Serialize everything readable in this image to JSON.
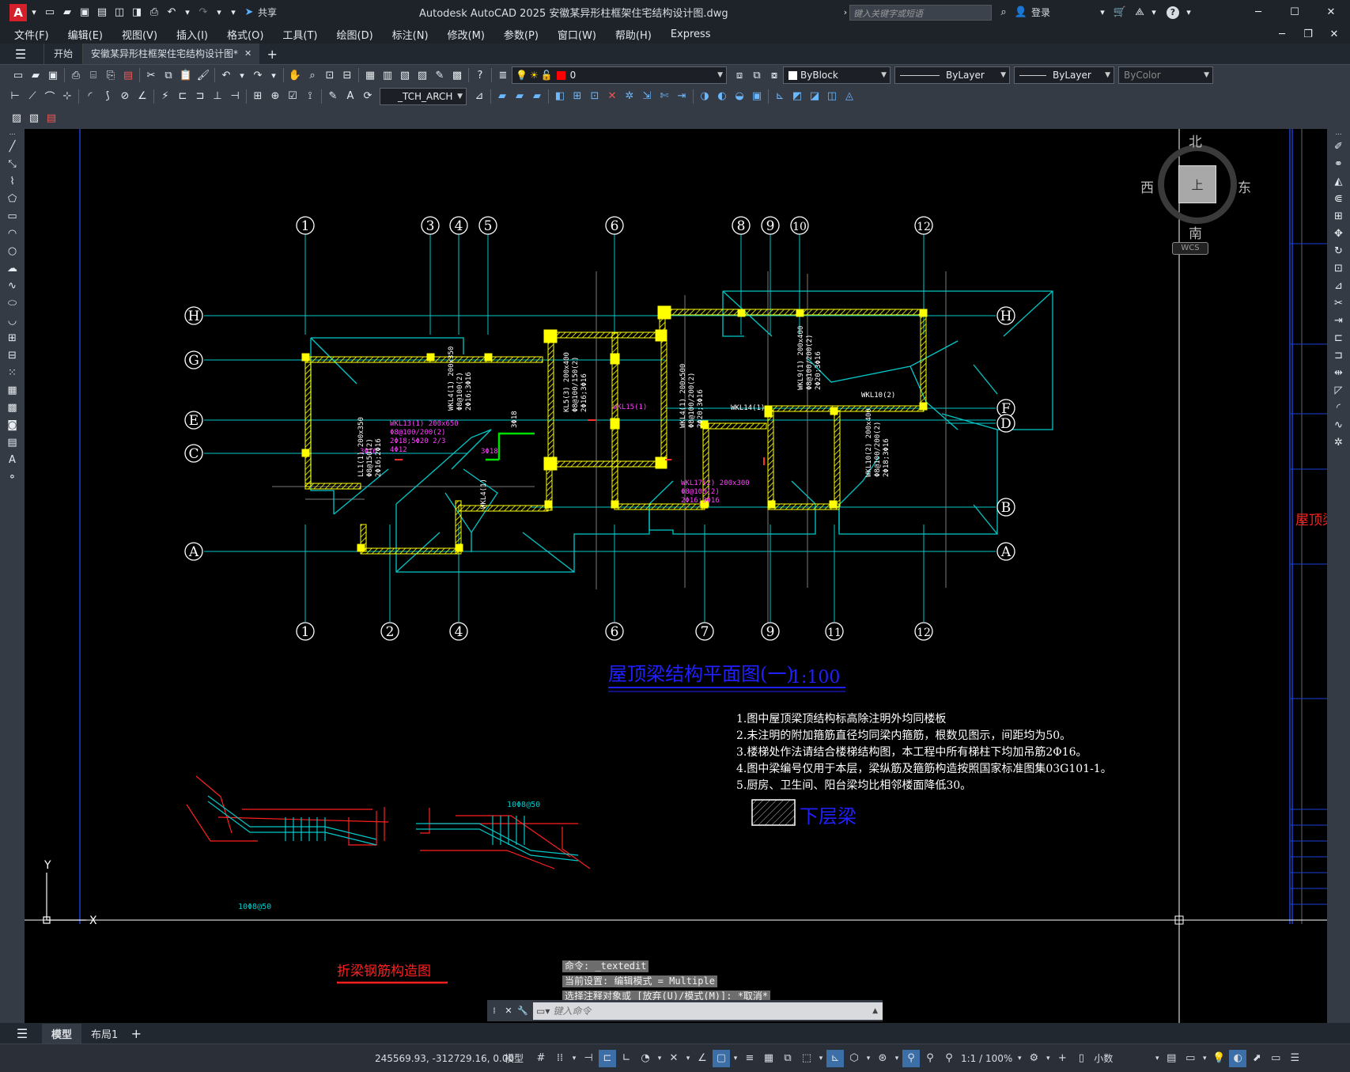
{
  "titlebar": {
    "app_letter": "A",
    "share_label": "共享",
    "title": "Autodesk AutoCAD 2025    安徽某异形柱框架住宅结构设计图.dwg",
    "search_placeholder": "键入关键字或短语",
    "login_label": "登录"
  },
  "menus": [
    "文件(F)",
    "编辑(E)",
    "视图(V)",
    "插入(I)",
    "格式(O)",
    "工具(T)",
    "绘图(D)",
    "标注(N)",
    "修改(M)",
    "参数(P)",
    "窗口(W)",
    "帮助(H)",
    "Express"
  ],
  "tabs": {
    "start": "开始",
    "active": "安徽某异形柱框架住宅结构设计图*"
  },
  "properties": {
    "layer_value": "0",
    "color": "ByBlock",
    "linetype": "ByLayer",
    "lineweight": "ByLayer",
    "plotstyle": "ByColor",
    "textstyle": "_TCH_ARCH"
  },
  "viewcube": {
    "north": "北",
    "south": "南",
    "east": "东",
    "west": "西",
    "top": "上",
    "wcs": "WCS"
  },
  "drawing": {
    "top_axes": [
      "1",
      "3",
      "4",
      "5",
      "6",
      "8",
      "9",
      "10",
      "12"
    ],
    "bottom_axes": [
      "1",
      "2",
      "4",
      "6",
      "7",
      "9",
      "11",
      "12"
    ],
    "left_rows": [
      "H",
      "G",
      "E",
      "C",
      "A"
    ],
    "right_rows": [
      "H",
      "F",
      "D",
      "B",
      "A"
    ],
    "plan_title": "屋顶梁结构平面图(一)",
    "plan_scale": "1:100",
    "notes": [
      "1.图中屋顶梁顶结构标高除注明外均同楼板",
      "2.未注明的附加箍筋直径均同梁内箍筋，根数见图示，间距均为50。",
      "3.楼梯处作法请结合楼梯结构图，本工程中所有梯柱下均加吊筋2Φ16。",
      "4.图中梁编号仅用于本层，梁纵筋及箍筋构造按照国家标准图集03G101-1。",
      "5.厨房、卫生间、阳台梁均比相邻楼面降低30。"
    ],
    "legend_label": "下层梁",
    "detail_title": "折梁钢筋构造图",
    "detail_labels": [
      "10Φ8@50",
      "10Φ8@50"
    ],
    "beam_labels": {
      "wkl13": [
        "WKL13(1) 200x650",
        "Φ8@100/200(2)",
        "2Φ18;5Φ20 2/3",
        "4Φ12"
      ],
      "wkl15": "WKL15(1)",
      "wkl17": [
        "WKL17(2) 200x300",
        "Φ8@100(2)",
        "2Φ16;3Φ16"
      ],
      "wkl14": "WKL14(1)",
      "wkl10": "WKL10(2)",
      "wkl10b": [
        "WKL10(2) 200x400",
        "Φ8@100/200(2)",
        "2Φ18;3Φ16"
      ],
      "wkl9": [
        "WKL9(1) 200x400",
        "Φ8@100/200(2)",
        "2Φ20;3Φ16"
      ],
      "wkl11": [
        "WKL4(1) 200x500",
        "Φ8@100/200(2)",
        "2Φ20;3Φ16"
      ],
      "kl5": [
        "KL5(3) 200x400",
        "Φ8@100/150(2)",
        "2Φ16;3Φ16"
      ],
      "wkl4": [
        "WKL4(1) 200x350",
        "Φ8@100(2)",
        "2Φ16;3Φ16"
      ],
      "ll1": [
        "LL1(1) 200x350",
        "Φ8@150(2)",
        "2Φ16;2Φ16"
      ],
      "wkl4b": "WKL4(1)",
      "r1": "3Φ16",
      "r2": "3Φ18",
      "r3": "3Φ18",
      "title_block_red": "屋顶梁"
    }
  },
  "command": {
    "history": [
      "命令: _textedit",
      "当前设置: 编辑模式 = Multiple",
      "选择注释对象或 [放弃(U)/模式(M)]: *取消*"
    ],
    "placeholder": "键入命令"
  },
  "layout_tabs": [
    "模型",
    "布局1"
  ],
  "status": {
    "coords": "245569.93, -312729.16, 0.00",
    "model": "模型",
    "scale": "1:1 / 100%",
    "units": "小数"
  },
  "colors": {
    "canvas": "#000000",
    "cyan": "#00c8c8",
    "yellow": "#ffff00",
    "magenta": "#ff00ff",
    "blue": "#2020ff",
    "red": "#ff2020"
  }
}
